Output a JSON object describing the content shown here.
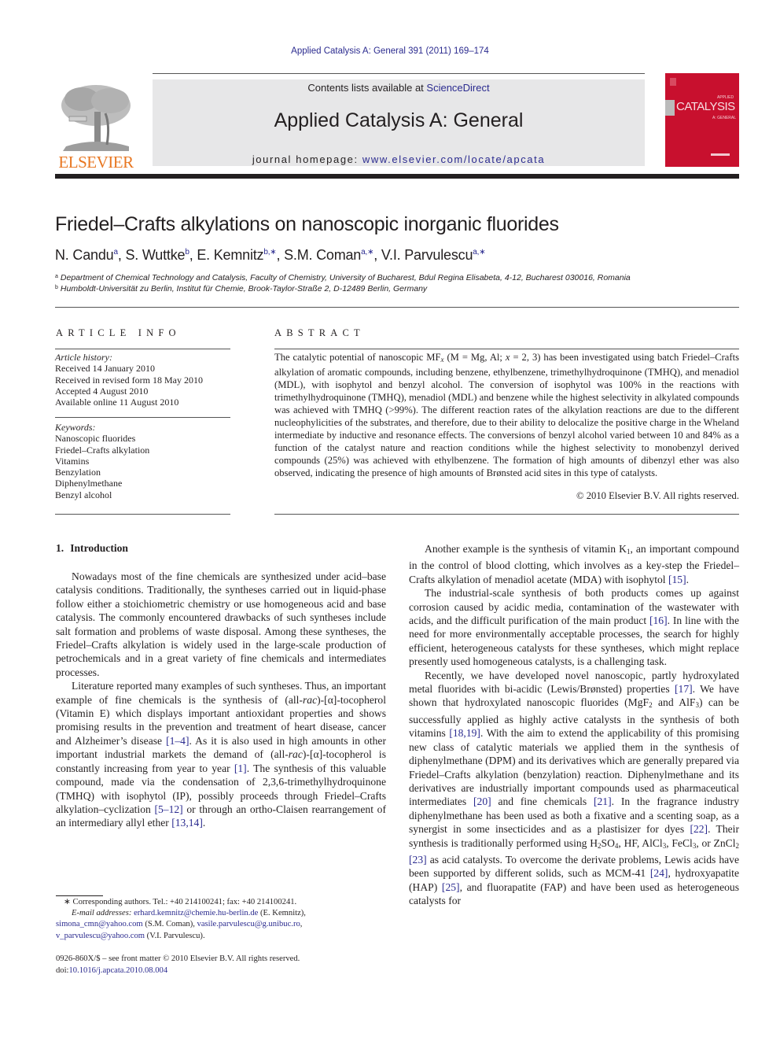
{
  "header": {
    "running_head": "Applied Catalysis A: General 391 (2011) 169–174",
    "contents_prefix": "Contents lists available at ",
    "contents_link": "ScienceDirect",
    "journal_title": "Applied Catalysis A: General",
    "homepage_prefix": "journal homepage: ",
    "homepage_link": "www.elsevier.com/locate/apcata",
    "publisher_logo_text": "ELSEVIER",
    "cover_title": "CATALYSIS",
    "cover_subtitle_top": "APPLIED",
    "cover_subtitle_bottom": "A: GENERAL",
    "colors": {
      "link": "#2b2b8f",
      "elsevier_orange": "#e87722",
      "cover_red": "#c8102e",
      "masthead_gray": "#e7e7e8"
    }
  },
  "article": {
    "title": "Friedel–Crafts alkylations on nanoscopic inorganic fluorides",
    "authors": [
      {
        "name": "N. Candu",
        "sup": "a"
      },
      {
        "name": "S. Wuttke",
        "sup": "b"
      },
      {
        "name": "E. Kemnitz",
        "sup": "b,∗"
      },
      {
        "name": "S.M. Coman",
        "sup": "a,∗"
      },
      {
        "name": "V.I. Parvulescu",
        "sup": "a,∗"
      }
    ],
    "affiliations": [
      {
        "mark": "a",
        "text": "Department of Chemical Technology and Catalysis, Faculty of Chemistry, University of Bucharest, Bdul Regina Elisabeta, 4-12, Bucharest 030016, Romania"
      },
      {
        "mark": "b",
        "text": "Humboldt-Universität zu Berlin, Institut für Chemie, Brook-Taylor-Straße 2, D-12489 Berlin, Germany"
      }
    ]
  },
  "article_info": {
    "heading": "ARTICLE INFO",
    "history_label": "Article history:",
    "history": [
      "Received 14 January 2010",
      "Received in revised form 18 May 2010",
      "Accepted 4 August 2010",
      "Available online 11 August 2010"
    ],
    "keywords_label": "Keywords:",
    "keywords": [
      "Nanoscopic fluorides",
      "Friedel–Crafts alkylation",
      "Vitamins",
      "Benzylation",
      "Diphenylmethane",
      "Benzyl alcohol"
    ]
  },
  "abstract": {
    "heading": "ABSTRACT",
    "p1": "The catalytic potential of nanoscopic MF",
    "p1_sub": "x",
    "p2": " (M = Mg, Al; ",
    "p2_var": "x",
    "p3": " = 2, 3) has been investigated using batch Friedel–Crafts alkylation of aromatic compounds, including benzene, ethylbenzene, trimethylhydroquinone (TMHQ), and menadiol (MDL), with isophytol and benzyl alcohol. The conversion of isophytol was 100% in the reactions with trimethylhydroquinone (TMHQ), menadiol (MDL) and benzene while the highest selectivity in alkylated compounds was achieved with TMHQ (>99%). The different reaction rates of the alkylation reactions are due to the different nucleophylicities of the substrates, and therefore, due to their ability to delocalize the positive charge in the Wheland intermediate by inductive and resonance effects. The conversions of benzyl alcohol varied between 10 and 84% as a function of the catalyst nature and reaction conditions while the highest selectivity to monobenzyl derived compounds (25%) was achieved with ethylbenzene. The formation of high amounts of dibenzyl ether was also observed, indicating the presence of high amounts of Brønsted acid sites in this type of catalysts.",
    "copyright": "© 2010 Elsevier B.V. All rights reserved."
  },
  "body": {
    "section_number": "1.",
    "section_title": "Introduction",
    "left": {
      "p1": "Nowadays most of the fine chemicals are synthesized under acid–base catalysis conditions. Traditionally, the syntheses carried out in liquid-phase follow either a stoichiometric chemistry or use homogeneous acid and base catalysis. The commonly encountered drawbacks of such syntheses include salt formation and problems of waste disposal. Among these syntheses, the Friedel–Crafts alkylation is widely used in the large-scale production of petrochemicals and in a great variety of fine chemicals and intermediates processes.",
      "p2a": "Literature reported many examples of such syntheses. Thus, an important example of fine chemicals is the synthesis of (all-",
      "rac": "rac",
      "p2b": ")-[α]-tocopherol (Vitamin E) which displays important antioxidant properties and shows promising results in the prevention and treatment of heart disease, cancer and Alzheimer’s disease ",
      "ref1": "[1–4]",
      "p2c": ". As it is also used in high amounts in other important industrial markets the demand of (all-",
      "p2d": ")-[α]-tocopherol is constantly increasing from year to year ",
      "ref2": "[1]",
      "p2e": ". The synthesis of this valuable compound, made via the condensation of 2,3,6-trimethylhydroquinone (TMHQ) with isophytol (IP), possibly proceeds through Friedel–Crafts alkylation–cyclization ",
      "ref3": "[5–12]",
      "p2f": " or through an ortho-Claisen rearrangement of an intermediary allyl ether ",
      "ref4": "[13,14]",
      "p2g": "."
    },
    "right": {
      "p1a": "Another example is the synthesis of vitamin K",
      "p1_sub": "1",
      "p1b": ", an important compound in the control of blood clotting, which involves as a key-step the Friedel–Crafts alkylation of menadiol acetate (MDA) with isophytol ",
      "ref15": "[15]",
      "p1c": ".",
      "p2a": "The industrial-scale synthesis of both products comes up against corrosion caused by acidic media, contamination of the wastewater with acids, and the difficult purification of the main product ",
      "ref16": "[16]",
      "p2b": ". In line with the need for more environmentally acceptable processes, the search for highly efficient, heterogeneous catalysts for these syntheses, which might replace presently used homogeneous catalysts, is a challenging task.",
      "p3a": "Recently, we have developed novel nanoscopic, partly hydroxylated metal fluorides with bi-acidic (Lewis/Brønsted) properties ",
      "ref17": "[17]",
      "p3b": ". We have shown that hydroxylated nanoscopic fluorides (MgF",
      "sub2": "2",
      "p3c": " and AlF",
      "sub3": "3",
      "p3d": ") can be successfully applied as highly active catalysts in the synthesis of both vitamins ",
      "ref18": "[18,19]",
      "p3e": ". With the aim to extend the applicability of this promising new class of catalytic materials we applied them in the synthesis of diphenylmethane (DPM) and its derivatives which are generally prepared via Friedel–Crafts alkylation (benzylation) reaction. Diphenylmethane and its derivatives are industrially important compounds used as pharmaceutical intermediates ",
      "ref20": "[20]",
      "p3f": " and fine chemicals ",
      "ref21": "[21]",
      "p3g": ". In the fragrance industry diphenylmethane has been used as both a fixative and a scenting soap, as a synergist in some insecticides and as a plastisizer for dyes ",
      "ref22": "[22]",
      "p3h": ". Their synthesis is traditionally performed using H",
      "h2": "2",
      "so": "SO",
      "so4": "4",
      "p3i": ", HF, AlCl",
      "alcl3": "3",
      "p3j": ", FeCl",
      "fecl3": "3",
      "p3k": ", or ZnCl",
      "zncl2": "2",
      "p3l": " ",
      "ref23": "[23]",
      "p3m": " as acid catalysts. To overcome the derivate problems, Lewis acids have been supported by different solids, such as MCM-41 ",
      "ref24": "[24]",
      "p3n": ", hydroxyapatite (HAP) ",
      "ref25": "[25]",
      "p3o": ", and fluorapatite (FAP) and have been used as heterogeneous catalysts for"
    }
  },
  "footnotes": {
    "corresponding": "∗ Corresponding authors. Tel.: +40 214100241; fax: +40 214100241.",
    "email_label": "E-mail addresses:",
    "emails": [
      {
        "address": "erhard.kemnitz@chemie.hu-berlin.de",
        "owner": " (E. Kemnitz),"
      },
      {
        "address": "simona_cmn@yahoo.com",
        "owner": " (S.M. Coman), "
      },
      {
        "address": "vasile.parvulescu@g.unibuc.ro",
        "owner": ","
      },
      {
        "address": "v_parvulescu@yahoo.com",
        "owner": " (V.I. Parvulescu)."
      }
    ],
    "issn_line": "0926-860X/$ – see front matter © 2010 Elsevier B.V. All rights reserved.",
    "doi_label": "doi:",
    "doi": "10.1016/j.apcata.2010.08.004"
  }
}
